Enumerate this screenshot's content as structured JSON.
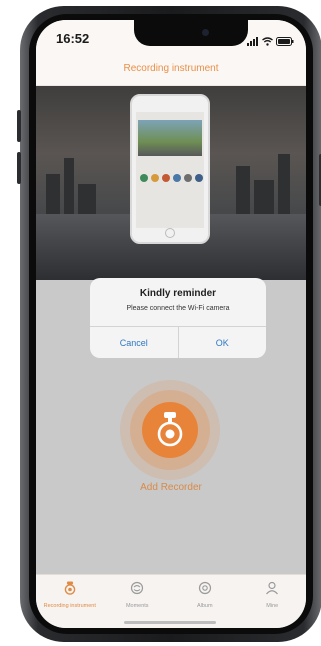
{
  "status": {
    "time": "16:52"
  },
  "nav": {
    "title": "Recording instrument"
  },
  "dialog": {
    "title": "Kindly reminder",
    "message": "Please connect the Wi-Fi camera",
    "cancel": "Cancel",
    "ok": "OK"
  },
  "add_recorder": {
    "label": "Add Recorder"
  },
  "tabs": [
    {
      "label": "Recording instrument",
      "icon": "recorder-icon",
      "active": true
    },
    {
      "label": "Moments",
      "icon": "moments-icon",
      "active": false
    },
    {
      "label": "Album",
      "icon": "album-icon",
      "active": false
    },
    {
      "label": "Mine",
      "icon": "person-icon",
      "active": false
    }
  ],
  "colors": {
    "accent": "#e8843a",
    "link": "#2f78c4"
  }
}
